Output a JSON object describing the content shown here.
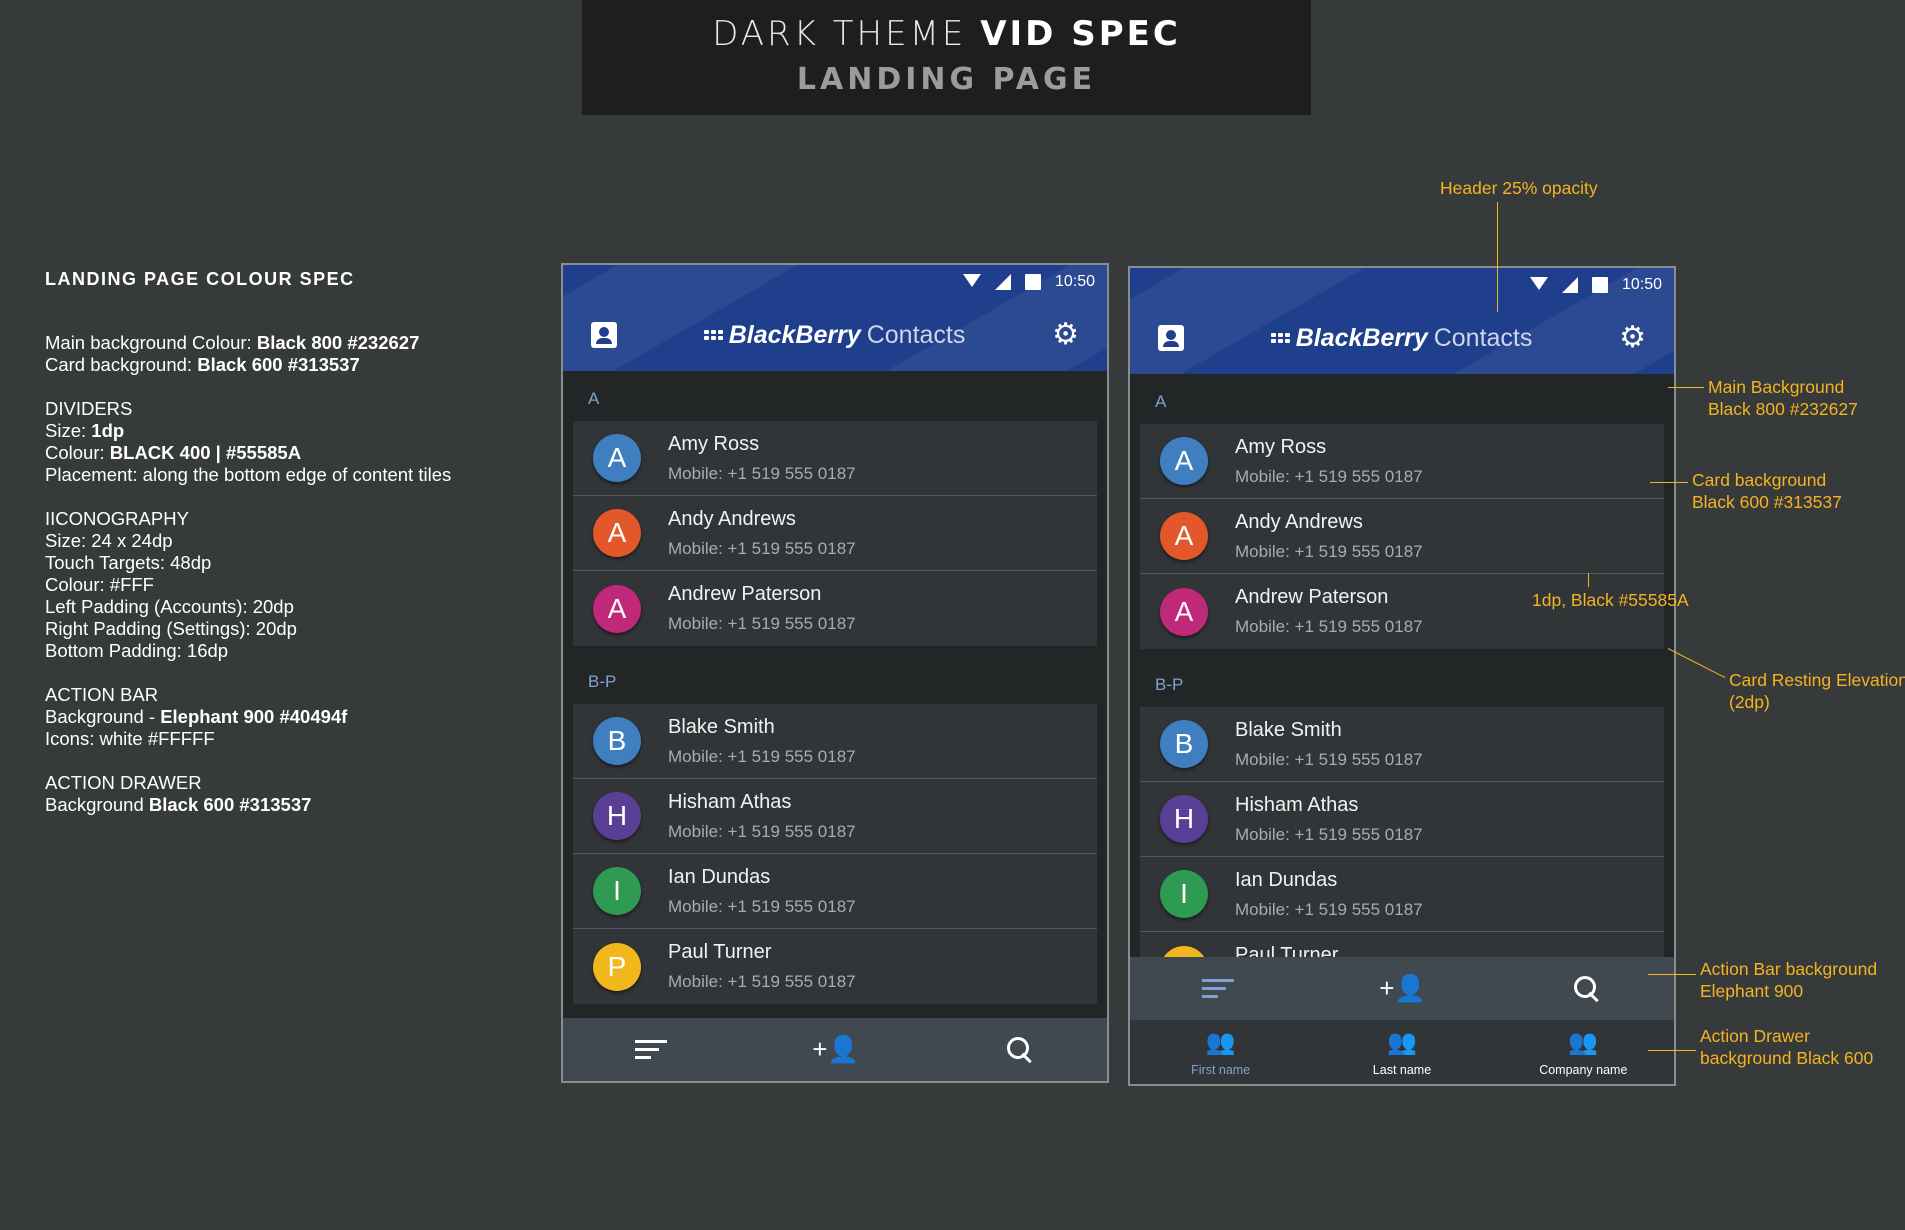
{
  "banner": {
    "title_light": "DARK THEME ",
    "title_bold": "VID SPEC",
    "subtitle": "LANDING PAGE"
  },
  "spec": {
    "heading": "LANDING PAGE COLOUR SPEC",
    "main_bg_prefix": "Main background Colour: ",
    "main_bg_value": "Black 800 #232627",
    "card_bg_prefix": "Card background: ",
    "card_bg_value": "Black 600 #313537",
    "dividers_title": "DIVIDERS",
    "div_size_prefix": "Size: ",
    "div_size_value": "1dp",
    "div_colour_prefix": "Colour: ",
    "div_colour_value": "BLACK 400 | #55585A",
    "div_placement": "Placement: along the bottom edge of content tiles",
    "icon_title": "IICONOGRAPHY",
    "icon_size": "Size: 24 x 24dp",
    "icon_touch": "Touch Targets: 48dp",
    "icon_colour": "Colour: #FFF",
    "icon_left": "Left Padding (Accounts): 20dp",
    "icon_right": "Right Padding (Settings): 20dp",
    "icon_bottom": "Bottom Padding: 16dp",
    "actionbar_title": "ACTION BAR",
    "actionbar_bg_prefix": "Background - ",
    "actionbar_bg_value": "Elephant 900 #40494f",
    "actionbar_icons": "Icons: white #FFFFF",
    "drawer_title": "ACTION DRAWER",
    "drawer_bg_prefix": "Background ",
    "drawer_bg_value": "Black 600 #313537"
  },
  "app": {
    "time": "10:50",
    "brand": "BlackBerry",
    "app_name": "Contacts",
    "section_a": "A",
    "section_bp": "B-P"
  },
  "contacts": [
    {
      "initial": "A",
      "name": "Amy Ross",
      "mobile": "Mobile: +1 519 555 0187",
      "color": "#3f7fc0"
    },
    {
      "initial": "A",
      "name": "Andy Andrews",
      "mobile": "Mobile: +1 519 555 0187",
      "color": "#e2582b"
    },
    {
      "initial": "A",
      "name": "Andrew Paterson",
      "mobile": "Mobile: +1 519 555 0187",
      "color": "#c0287a"
    },
    {
      "initial": "B",
      "name": "Blake Smith",
      "mobile": "Mobile: +1 519 555 0187",
      "color": "#3f7fc0"
    },
    {
      "initial": "H",
      "name": "Hisham Athas",
      "mobile": "Mobile: +1 519 555 0187",
      "color": "#5b3f96"
    },
    {
      "initial": "I",
      "name": "Ian Dundas",
      "mobile": "Mobile: +1 519 555 0187",
      "color": "#2e9a52"
    },
    {
      "initial": "P",
      "name": "Paul Turner",
      "mobile": "Mobile: +1 519 555 0187",
      "color": "#f3b71e"
    }
  ],
  "drawer": {
    "tab1": "First name",
    "tab2": "Last name",
    "tab3": "Company name"
  },
  "annotations": {
    "header": "Header 25% opacity",
    "main_bg_1": "Main Background",
    "main_bg_2": "Black 800 #232627",
    "card_bg_1": "Card background",
    "card_bg_2": "Black 600 #313537",
    "divider": "1dp, Black #55585A",
    "elev_1": "Card Resting Elevation",
    "elev_2": "(2dp)",
    "actionbar_1": "Action Bar background",
    "actionbar_2": "Elephant 900",
    "drawer_1": "Action Drawer",
    "drawer_2": "background Black 600"
  },
  "colors": {
    "main_bg": "#232627",
    "card_bg": "#313537",
    "divider": "#55585A",
    "action_bar": "#40494f",
    "header": "#1f3f8c",
    "annotation": "#f4b321"
  }
}
